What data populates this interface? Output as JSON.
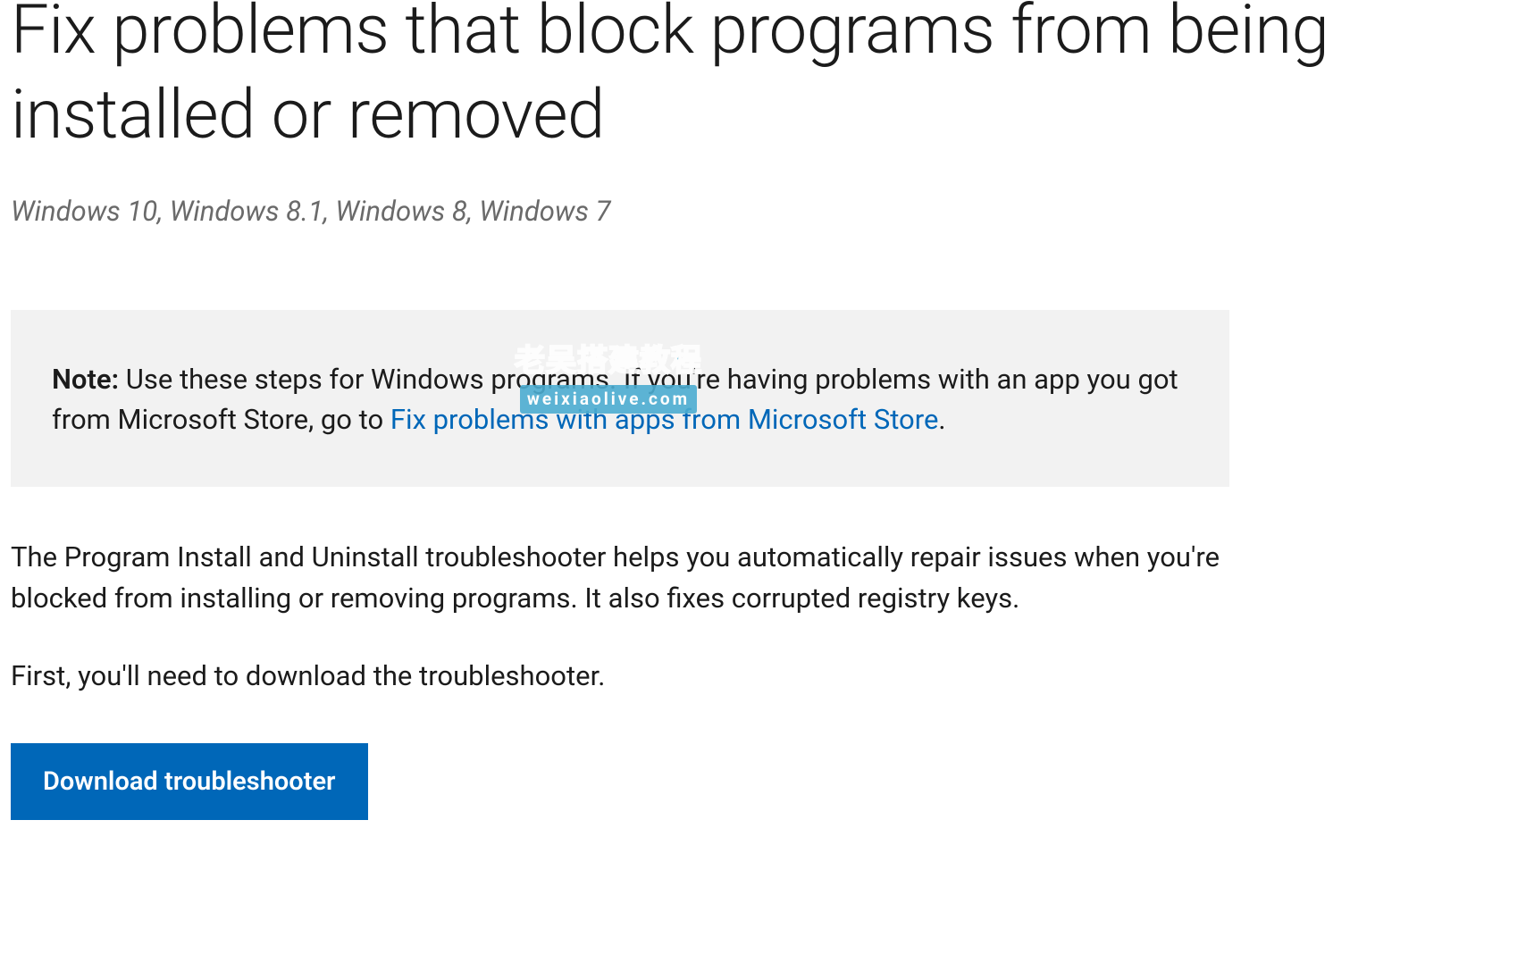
{
  "page": {
    "title": "Fix problems that block programs from being installed or removed",
    "applies_to": "Windows 10, Windows 8.1, Windows 8, Windows 7"
  },
  "note": {
    "label": "Note:",
    "text_before_link": " Use these steps for Windows programs. If you're having problems with an app you got from Microsoft Store, go to ",
    "link_text": "Fix problems with apps from Microsoft Store",
    "text_after_link": "."
  },
  "watermark": {
    "line1": "老吴搭建教程",
    "line2": "weixiaolive.com"
  },
  "body": {
    "para1": "The Program Install and Uninstall troubleshooter helps you automatically repair issues when you're blocked from installing or removing programs. It also fixes corrupted registry keys.",
    "para2": "First, you'll need to download the troubleshooter."
  },
  "button": {
    "download_label": "Download troubleshooter"
  }
}
